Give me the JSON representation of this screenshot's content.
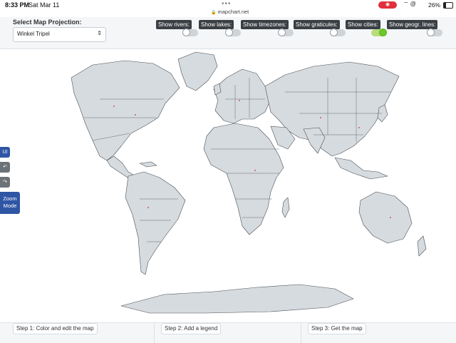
{
  "status_bar": {
    "time": "8:33 PM",
    "date": "Sat Mar 11",
    "url": "mapchart.net",
    "battery": "26%",
    "recording_color": "#e0303b"
  },
  "toolbar": {
    "projection_label": "Select Map Projection:",
    "projection_value": "Winkel Tripel",
    "toggles": [
      {
        "label": "Show rivers:",
        "on": false
      },
      {
        "label": "Show lakes:",
        "on": false
      },
      {
        "label": "Show timezones:",
        "on": false
      },
      {
        "label": "Show graticules:",
        "on": false
      },
      {
        "label": "Show cities:",
        "on": true
      },
      {
        "label": "Show geogr. lines:",
        "on": false
      }
    ]
  },
  "side_buttons": {
    "ui": "UI",
    "undo_icon": "undo-icon",
    "redo_icon": "redo-icon",
    "zoom": "Zoom Mode"
  },
  "steps": [
    {
      "label": "Step 1: Color and edit the map"
    },
    {
      "label": "Step 2: Add a legend"
    },
    {
      "label": "Step 3: Get the map"
    }
  ],
  "colors": {
    "land": "#d6dbdf",
    "borders": "#4a4f54",
    "accent_blue": "#2f56a5",
    "toggle_on": "#6cc62c"
  }
}
